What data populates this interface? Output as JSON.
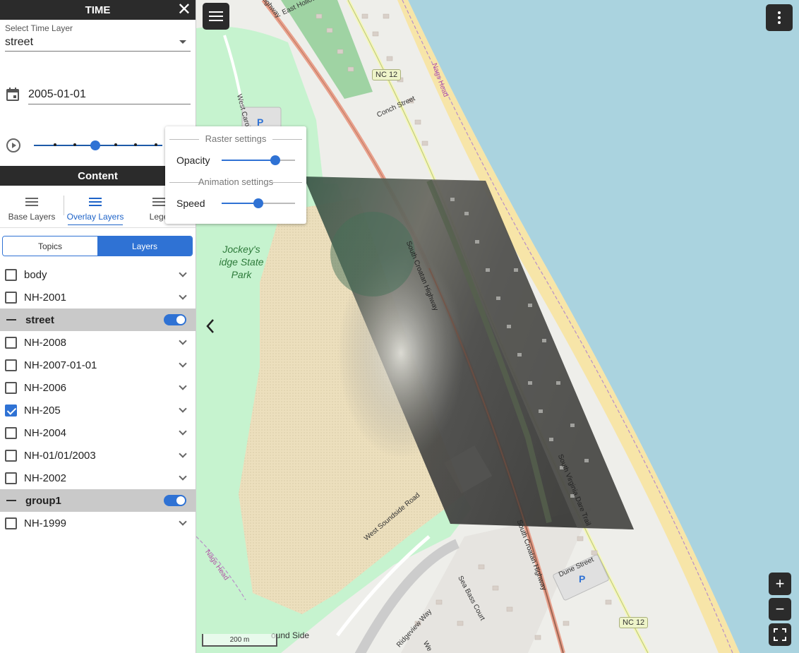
{
  "panel": {
    "title": "TIME",
    "time_layer": {
      "label": "Select Time Layer",
      "value": "street"
    },
    "date": "2005-01-01",
    "timeline": {
      "steps": 7,
      "current_index": 3
    },
    "content_title": "Content",
    "tabs": [
      {
        "label": "Base Layers",
        "active": false
      },
      {
        "label": "Overlay Layers",
        "active": true
      },
      {
        "label": "Lege",
        "active": false
      }
    ],
    "segments": {
      "topics": "Topics",
      "layers": "Layers",
      "active": "layers"
    },
    "layers": [
      {
        "label": "body",
        "type": "layer",
        "checked": false
      },
      {
        "label": "NH-2001",
        "type": "layer",
        "checked": false
      },
      {
        "label": "street",
        "type": "group",
        "enabled": true
      },
      {
        "label": "NH-2008",
        "type": "layer",
        "checked": false
      },
      {
        "label": "NH-2007-01-01",
        "type": "layer",
        "checked": false
      },
      {
        "label": "NH-2006",
        "type": "layer",
        "checked": false
      },
      {
        "label": "NH-205",
        "type": "layer",
        "checked": true
      },
      {
        "label": "NH-2004",
        "type": "layer",
        "checked": false
      },
      {
        "label": "NH-01/01/2003",
        "type": "layer",
        "checked": false
      },
      {
        "label": "NH-2002",
        "type": "layer",
        "checked": false
      },
      {
        "label": "group1",
        "type": "group",
        "enabled": true
      },
      {
        "label": "NH-1999",
        "type": "layer",
        "checked": false
      }
    ]
  },
  "settings_popup": {
    "raster_title": "Raster settings",
    "opacity_label": "Opacity",
    "opacity_value": 0.73,
    "animation_title": "Animation settings",
    "speed_label": "Speed",
    "speed_value": 0.5
  },
  "map": {
    "labels": {
      "nc12_top": "NC 12",
      "nc12_bottom": "NC 12",
      "conch_street": "Conch Street",
      "nags_head_1": "Nags Head",
      "nags_head_2": "Nags Head",
      "jockeys_ridge": "Jockey's Ridge State Park",
      "jockeys_line1": "Jockey's",
      "jockeys_line2": "idge State",
      "jockeys_line3": "Park",
      "highway_top": "Highway",
      "east_hollow": "East Hollow",
      "west_carol": "West Carol",
      "south_croatan": "South Croatan Highway",
      "south_croatan_lower": "South Croatan Highway",
      "south_virginia": "South Virginia Dare Trail",
      "west_soundside": "West Soundside Road",
      "sea_bass_court": "Sea Bass Court",
      "ridgeview_way": "Ridgeview Way",
      "dune_street": "Dune Street",
      "sound_side": "ound Side",
      "we": "We",
      "parking": "P"
    },
    "scale_label": "200 m"
  },
  "controls": {
    "menu_icon": "hamburger-icon",
    "more_icon": "vertical-dots-icon",
    "zoom_in": "+",
    "zoom_out": "−",
    "fullscreen_icon": "fullscreen-icon",
    "collapse_icon": "chevron-left-icon"
  },
  "colors": {
    "accent": "#2f72d4",
    "dark": "#2b2b2b",
    "water": "#aad3df",
    "sand": "#f7e5a8",
    "park": "#c6f3cf",
    "dune": "#ece2c2"
  }
}
